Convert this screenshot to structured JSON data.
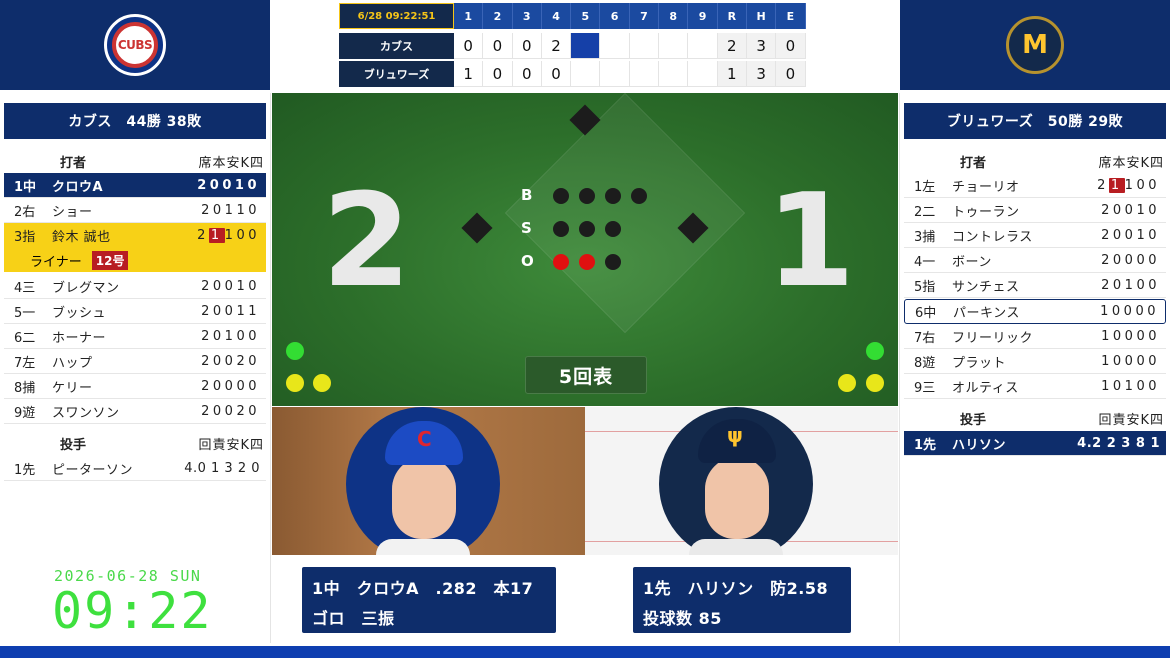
{
  "teams": {
    "away": {
      "logo": "cubs-logo",
      "logo_text": "CUBS"
    },
    "home": {
      "logo": "brewers-logo",
      "logo_text": "M"
    }
  },
  "linescore": {
    "datetime": "6/28 09:22:51",
    "innings": [
      "1",
      "2",
      "3",
      "4",
      "5",
      "6",
      "7",
      "8",
      "9"
    ],
    "rhe": [
      "R",
      "H",
      "E"
    ],
    "rows": [
      {
        "team": "カブス",
        "scores": [
          "0",
          "0",
          "0",
          "2",
          "",
          "",
          "",
          "",
          ""
        ],
        "r": "2",
        "h": "3",
        "e": "0"
      },
      {
        "team": "ブリュワーズ",
        "scores": [
          "1",
          "0",
          "0",
          "0",
          "",
          "",
          "",
          "",
          ""
        ],
        "r": "1",
        "h": "3",
        "e": "0"
      }
    ]
  },
  "away_panel": {
    "title": "カブス　44勝 38敗",
    "batter_header": {
      "label": "打者",
      "stats": "席本安K四"
    },
    "batters": [
      {
        "ord": "1中",
        "name": "クロウA",
        "stats": "20010"
      },
      {
        "ord": "2右",
        "name": "ショー",
        "stats": "20110"
      },
      {
        "ord": "3指",
        "name": "鈴木 誠也",
        "stats_a": "2",
        "stats_hl": "1",
        "stats_b": "100"
      },
      {
        "ord": "4三",
        "name": "ブレグマン",
        "stats": "20010"
      },
      {
        "ord": "5一",
        "name": "ブッシュ",
        "stats": "20011"
      },
      {
        "ord": "6二",
        "name": "ホーナー",
        "stats": "20100"
      },
      {
        "ord": "7左",
        "name": "ハップ",
        "stats": "20020"
      },
      {
        "ord": "8捕",
        "name": "ケリー",
        "stats": "20000"
      },
      {
        "ord": "9遊",
        "name": "スワンソン",
        "stats": "20020"
      }
    ],
    "liner": {
      "text": "ライナー",
      "badge": "12号"
    },
    "pitcher_header": {
      "label": "投手",
      "stats": "回責安K四"
    },
    "pitchers": [
      {
        "ord": "1先",
        "name": "ピーターソン",
        "stats": "4.0 1 3 2 0"
      }
    ]
  },
  "home_panel": {
    "title": "ブリュワーズ　50勝 29敗",
    "batter_header": {
      "label": "打者",
      "stats": "席本安K四"
    },
    "batters": [
      {
        "ord": "1左",
        "name": "チョーリオ",
        "stats_a": "2",
        "stats_hl": "1",
        "stats_b": "100"
      },
      {
        "ord": "2二",
        "name": "トゥーラン",
        "stats": "20010"
      },
      {
        "ord": "3捕",
        "name": "コントレラス",
        "stats": "20010"
      },
      {
        "ord": "4一",
        "name": "ボーン",
        "stats": "20000"
      },
      {
        "ord": "5指",
        "name": "サンチェス",
        "stats": "20100"
      },
      {
        "ord": "6中",
        "name": "パーキンス",
        "stats": "10000"
      },
      {
        "ord": "7右",
        "name": "フリーリック",
        "stats": "10000"
      },
      {
        "ord": "8遊",
        "name": "プラット",
        "stats": "10000"
      },
      {
        "ord": "9三",
        "name": "オルティス",
        "stats": "10100"
      }
    ],
    "pitcher_header": {
      "label": "投手",
      "stats": "回責安K四"
    },
    "pitchers": [
      {
        "ord": "1先",
        "name": "ハリソン",
        "stats": "4.2 2 3 8 1"
      }
    ]
  },
  "field": {
    "away_score": "2",
    "home_score": "1",
    "count_labels": [
      "B",
      "S",
      "O"
    ],
    "balls": 0,
    "strikes": 0,
    "outs": 2,
    "inning": "5回表",
    "colors": {
      "out_light": "#e01010",
      "off_light": "#1c1c1c"
    }
  },
  "batter_info": {
    "line1": "1中　クロウA　.282　本17",
    "line2": "ゴロ　三振"
  },
  "pitcher_info": {
    "line1": "1先　ハリソン　防2.58",
    "line2": "投球数 85"
  },
  "clock": {
    "date": "2026-06-28 SUN",
    "time": "09:22"
  },
  "colors": {
    "navy": "#0e2d6b",
    "highlight_yellow": "#f7d117",
    "highlight_red": "#b81d22",
    "clock_green": "#3ee03e"
  }
}
